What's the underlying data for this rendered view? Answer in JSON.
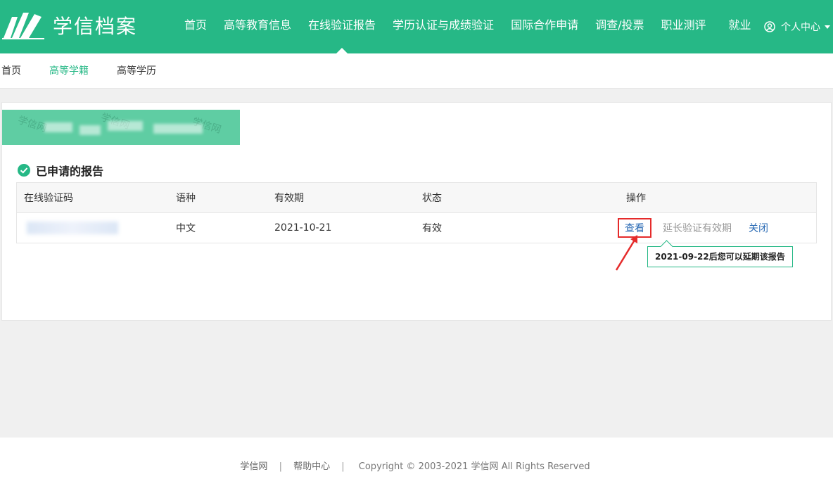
{
  "brand": {
    "name": "学信档案"
  },
  "nav": {
    "items": [
      "首页",
      "高等教育信息",
      "在线验证报告",
      "学历认证与成绩验证",
      "国际合作申请",
      "调查/投票",
      "职业测评",
      "就业"
    ],
    "active_index": 2,
    "user_center": "个人中心"
  },
  "subnav": {
    "items": [
      "首页",
      "高等学籍",
      "高等学历"
    ],
    "active_index": 1
  },
  "section": {
    "title": "已申请的报告"
  },
  "table": {
    "columns": [
      "在线验证码",
      "语种",
      "有效期",
      "状态",
      "操作"
    ],
    "rows": [
      {
        "language": "中文",
        "valid_until": "2021-10-21",
        "status": "有效",
        "actions": {
          "view": "查看",
          "extend": "延长验证有效期",
          "close": "关闭"
        }
      }
    ]
  },
  "tooltip": {
    "text": "2021-09-22后您可以延期该报告"
  },
  "footer": {
    "links": [
      "学信网",
      "帮助中心"
    ],
    "copyright": "Copyright © 2003-2021 学信网 All Rights Reserved"
  },
  "colors": {
    "brand": "#26b886",
    "link": "#2b6bb5",
    "highlight": "#e52b2b"
  }
}
